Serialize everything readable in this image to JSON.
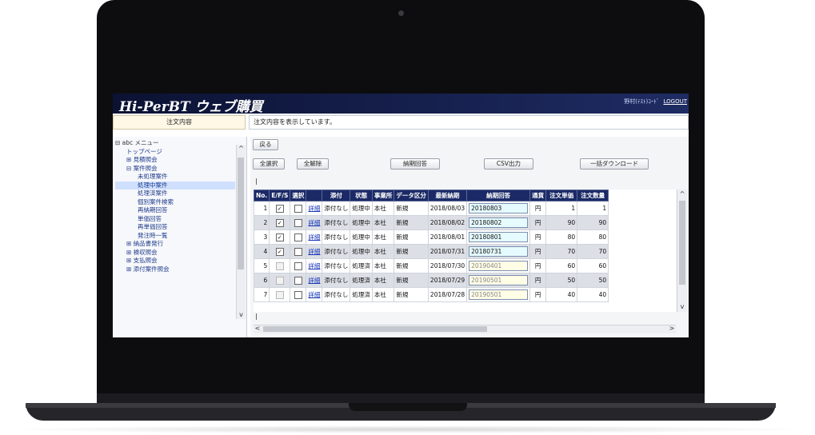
{
  "app": {
    "title": "Hi-PerBT ウェブ購買",
    "user_label": "野村(ﾃｽﾄ)ｺｰﾄﾞ",
    "logout_label": "LOGOUT"
  },
  "tabbar": {
    "active_tab": "注文内容",
    "message": "注文内容を表示しています。"
  },
  "sidebar": {
    "items": [
      {
        "label": "⊟ abc メニュー",
        "level": 0
      },
      {
        "label": "トップページ",
        "level": 1
      },
      {
        "label": "⊞ 見積照会",
        "level": 1
      },
      {
        "label": "⊟ 案件照会",
        "level": 1
      },
      {
        "label": "未処理案件",
        "level": 2
      },
      {
        "label": "処理中案件",
        "level": 2
      },
      {
        "label": "処理済案件",
        "level": 2
      },
      {
        "label": "個別案件検索",
        "level": 2
      },
      {
        "label": "再納期回答",
        "level": 2
      },
      {
        "label": "単価回答",
        "level": 2
      },
      {
        "label": "再単価回答",
        "level": 2
      },
      {
        "label": "発注時一覧",
        "level": 2
      },
      {
        "label": "⊞ 納品書発行",
        "level": 1
      },
      {
        "label": "⊞ 検収照会",
        "level": 1
      },
      {
        "label": "⊞ 支払照会",
        "level": 1
      },
      {
        "label": "⊞ 添付案件照会",
        "level": 1
      }
    ]
  },
  "toolbar": {
    "back": "戻る",
    "select_all": "全選択",
    "deselect_all": "全解除",
    "delivery_reply": "納期回答",
    "csv_output": "CSV出力",
    "bulk_download": "一括ダウンロード"
  },
  "cursor_marks": [
    "|",
    "|"
  ],
  "table": {
    "headers": [
      "No.",
      "E/F/S",
      "選択",
      "",
      "添付",
      "状態",
      "事業所",
      "データ区分",
      "最新納期",
      "納期回答",
      "通貨",
      "注文単価",
      "注文数量"
    ],
    "rows": [
      {
        "no": "1",
        "checked": true,
        "enabled": true,
        "link": "詳細",
        "attach": "添付なし",
        "status": "処理中",
        "office": "本社",
        "kind": "新規",
        "latest": "2018/08/03",
        "reply": "20180803",
        "reply_style": "cyan",
        "currency": "円",
        "price": "1",
        "qty": "1"
      },
      {
        "no": "2",
        "checked": true,
        "enabled": true,
        "link": "詳細",
        "attach": "添付なし",
        "status": "処理中",
        "office": "本社",
        "kind": "新規",
        "latest": "2018/08/02",
        "reply": "20180802",
        "reply_style": "cyan",
        "currency": "円",
        "price": "90",
        "qty": "90"
      },
      {
        "no": "3",
        "checked": true,
        "enabled": true,
        "link": "詳細",
        "attach": "添付なし",
        "status": "処理中",
        "office": "本社",
        "kind": "新規",
        "latest": "2018/08/01",
        "reply": "20180801",
        "reply_style": "cyan",
        "currency": "円",
        "price": "80",
        "qty": "80"
      },
      {
        "no": "4",
        "checked": true,
        "enabled": true,
        "link": "詳細",
        "attach": "添付なし",
        "status": "処理中",
        "office": "本社",
        "kind": "新規",
        "latest": "2018/07/31",
        "reply": "20180731",
        "reply_style": "cyan",
        "currency": "円",
        "price": "70",
        "qty": "70"
      },
      {
        "no": "5",
        "checked": false,
        "enabled": false,
        "link": "詳細",
        "attach": "添付なし",
        "status": "処理済",
        "office": "本社",
        "kind": "新規",
        "latest": "2018/07/30",
        "reply": "20190401",
        "reply_style": "yellow",
        "currency": "円",
        "price": "60",
        "qty": "60"
      },
      {
        "no": "6",
        "checked": false,
        "enabled": false,
        "link": "詳細",
        "attach": "添付なし",
        "status": "処理済",
        "office": "本社",
        "kind": "新規",
        "latest": "2018/07/29",
        "reply": "20190501",
        "reply_style": "yellow",
        "currency": "円",
        "price": "50",
        "qty": "50"
      },
      {
        "no": "7",
        "checked": false,
        "enabled": false,
        "link": "詳細",
        "attach": "添付なし",
        "status": "処理済",
        "office": "本社",
        "kind": "新規",
        "latest": "2018/07/28",
        "reply": "20190501",
        "reply_style": "yellow",
        "currency": "円",
        "price": "40",
        "qty": "40"
      }
    ]
  },
  "scroll_glyphs": {
    "up": "^",
    "down": "v",
    "left": "<",
    "right": ">"
  },
  "colors": {
    "header_bg": "#1b2a66",
    "app_bar": "#0b1233",
    "link": "#1736b8",
    "reply_cyan": "#e6fbff",
    "reply_yellow": "#fffde6"
  }
}
